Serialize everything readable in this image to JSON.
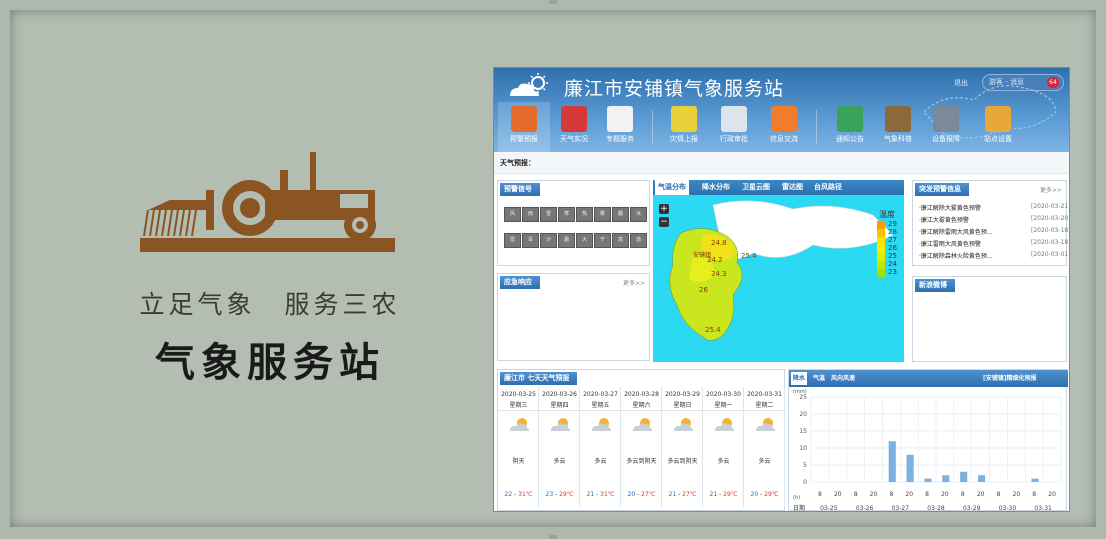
{
  "poster": {
    "slogan": "立足气象　服务三农",
    "title": "气象服务站"
  },
  "site": {
    "title": "廉江市安铺镇气象服务站",
    "logout": "退出",
    "user": "游客 - 消息",
    "badge": "64",
    "nav": [
      "预警预报",
      "天气实况",
      "专题服务",
      "灾情上报",
      "行政审批",
      "信息交流",
      "通知公告",
      "气象科普",
      "设备报障",
      "站点设置"
    ],
    "forecast_label": "天气预报：",
    "signal": {
      "title": "预警信号",
      "icons": [
        "风",
        "雨",
        "雪",
        "寒",
        "热",
        "雾",
        "霾",
        "冰",
        "雷",
        "旱",
        "沙",
        "霜",
        "大",
        "干",
        "高",
        "道"
      ]
    },
    "emergency": {
      "title": "应急响应",
      "more": "更多>>"
    },
    "map": {
      "tabs": [
        "气温分布",
        "降水分布",
        "卫星云图",
        "雷达图",
        "台风路径"
      ],
      "zoom_in": "+",
      "zoom_out": "−",
      "legend_title": "温度",
      "legend_values": [
        "29",
        "28",
        "27",
        "26",
        "25",
        "24",
        "23"
      ],
      "labels": [
        "24.8",
        "安铺镇",
        "24.2",
        "25.4",
        "24.3",
        "26",
        "25.4"
      ],
      "legend_colors": [
        "#ff9a00",
        "#ffc400",
        "#ffe100",
        "#f2f000",
        "#d9f000",
        "#bdea00",
        "#a6e000"
      ]
    },
    "alerts": {
      "title": "突发预警信息",
      "more": "更多>>",
      "items": [
        {
          "text": "·廉江解除大雾黄色预警",
          "date": "[2020-03-21]"
        },
        {
          "text": "·廉江大雾黄色预警",
          "date": "[2020-03-20]"
        },
        {
          "text": "·廉江解除雷雨大风黄色预...",
          "date": "[2020-03-18]"
        },
        {
          "text": "·廉江雷雨大风黄色预警",
          "date": "[2020-03-18]"
        },
        {
          "text": "·廉江解除森林火险黄色预...",
          "date": "[2020-03-01]"
        }
      ]
    },
    "weibo": {
      "title": "新浪微博"
    },
    "week": {
      "title": "廉江市 七天天气预报",
      "days": [
        {
          "date": "2020-03-25",
          "weekday": "星期三",
          "cond": "阴天",
          "lo": "22",
          "hi": "31℃"
        },
        {
          "date": "2020-03-26",
          "weekday": "星期四",
          "cond": "多云",
          "lo": "23",
          "hi": "29℃"
        },
        {
          "date": "2020-03-27",
          "weekday": "星期五",
          "cond": "多云",
          "lo": "21",
          "hi": "31℃"
        },
        {
          "date": "2020-03-28",
          "weekday": "星期六",
          "cond": "多云到阴天",
          "lo": "20",
          "hi": "27℃"
        },
        {
          "date": "2020-03-29",
          "weekday": "星期日",
          "cond": "多云到阴天",
          "lo": "21",
          "hi": "27℃"
        },
        {
          "date": "2020-03-30",
          "weekday": "星期一",
          "cond": "多云",
          "lo": "21",
          "hi": "29℃"
        },
        {
          "date": "2020-03-31",
          "weekday": "星期二",
          "cond": "多云",
          "lo": "20",
          "hi": "29℃"
        }
      ]
    },
    "rain": {
      "tabs": [
        "降水",
        "气温",
        "风向风速"
      ],
      "title": "[安铺镇]精细化预报",
      "unit": "(mm)",
      "hours_unit": "(h)",
      "date_label": "日期",
      "dates": [
        "03-25",
        "03-26",
        "03-27",
        "03-28",
        "03-29",
        "03-30",
        "03-31"
      ],
      "hours": [
        "8",
        "20",
        "8",
        "20",
        "8",
        "20",
        "8",
        "20",
        "8",
        "20",
        "8",
        "20",
        "8",
        "20"
      ]
    }
  },
  "chart_data": {
    "type": "bar",
    "title": "[安铺镇]精细化预报",
    "ylabel": "(mm)",
    "xlabel": "日期",
    "ylim": [
      0,
      25
    ],
    "yticks": [
      0,
      5,
      10,
      15,
      20,
      25
    ],
    "grid": true,
    "categories": [
      "03-27 8",
      "03-27 20",
      "03-28 8",
      "03-28 20",
      "03-29 8",
      "03-29 20",
      "03-30 8",
      "03-30 20",
      "03-31 8",
      "03-31 20"
    ],
    "values": [
      12,
      8,
      1,
      2,
      3,
      2,
      0,
      0,
      1,
      0
    ]
  }
}
